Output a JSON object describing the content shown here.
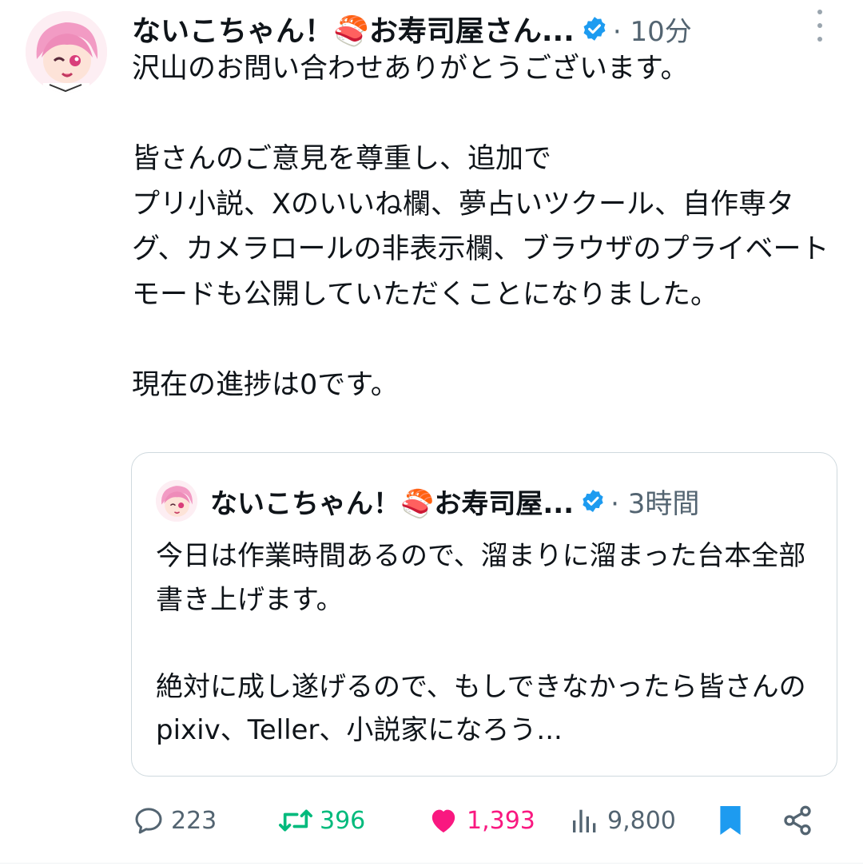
{
  "tweet": {
    "display_name": "ないこちゃん！🍣お寿司屋さん...",
    "time": "· 10分",
    "body": "沢山のお問い合わせありがとうございます。\n\n皆さんのご意見を尊重し、追加で\nプリ小説、Xのいいね欄、夢占いツクール、自作専タグ、カメラロールの非表示欄、ブラウザのプライベートモードも公開していただくことになりました。\n\n現在の進捗は0です。"
  },
  "quote": {
    "display_name": "ないこちゃん！🍣お寿司屋...",
    "time": "· 3時間",
    "body": "今日は作業時間あるので、溜まりに溜まった台本全部書き上げます。\n\n絶対に成し遂げるので、もしできなかったら皆さんのpixiv、Teller、小説家になろう..."
  },
  "actions": {
    "replies": "223",
    "retweets": "396",
    "likes": "1,393",
    "views": "9,800"
  },
  "icons": {
    "verified": "verified-badge-icon",
    "reply": "speech-bubble-icon",
    "retweet": "retweet-arrows-icon",
    "like": "heart-filled-icon",
    "views": "bar-chart-icon",
    "bookmark": "bookmark-filled-icon",
    "share": "share-icon",
    "more": "vertical-dots-icon"
  },
  "colors": {
    "verified": "#1d9bf0",
    "retweet": "#00ba7c",
    "like": "#f91880",
    "bookmark": "#1d9bf0",
    "muted": "#536471"
  }
}
